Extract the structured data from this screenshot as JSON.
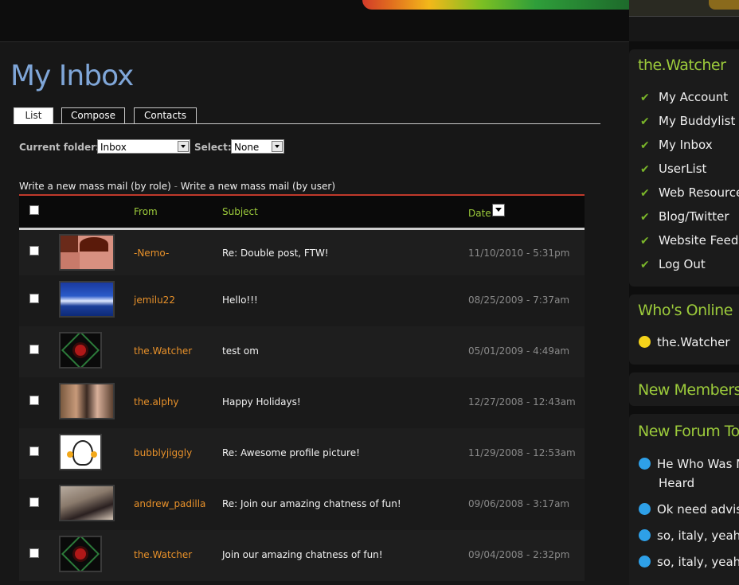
{
  "page": {
    "title": "My Inbox"
  },
  "tabs": [
    {
      "label": "List",
      "active": true
    },
    {
      "label": "Compose",
      "active": false
    },
    {
      "label": "Contacts",
      "active": false
    }
  ],
  "filters": {
    "folder_label": "Current folder:",
    "folder_value": "Inbox",
    "select_label": "Select:",
    "select_value": "None"
  },
  "massmail": {
    "by_role": "Write a new mass mail (by role)",
    "separator": "-",
    "by_user": "Write a new mass mail (by user)"
  },
  "table": {
    "headers": {
      "from": "From",
      "subject": "Subject",
      "date": "Date"
    },
    "rows": [
      {
        "from": "-Nemo-",
        "subject": "Re: Double post, FTW!",
        "date": "11/10/2010 - 5:31pm",
        "avatar": "nemo"
      },
      {
        "from": "jemilu22",
        "subject": "Hello!!!",
        "date": "08/25/2009 - 7:37am",
        "avatar": "wave"
      },
      {
        "from": "the.Watcher",
        "subject": "test om",
        "date": "05/01/2009 - 4:49am",
        "avatar": "symbol"
      },
      {
        "from": "the.alphy",
        "subject": "Happy Holidays!",
        "date": "12/27/2008 - 12:43am",
        "avatar": "couple"
      },
      {
        "from": "bubblyjiggly",
        "subject": "Re: Awesome profile picture!",
        "date": "11/29/2008 - 12:53am",
        "avatar": "ghost"
      },
      {
        "from": "andrew_padilla",
        "subject": "Re: Join our amazing chatness of fun!",
        "date": "09/06/2008 - 3:17am",
        "avatar": "man"
      },
      {
        "from": "the.Watcher",
        "subject": "Join our amazing chatness of fun!",
        "date": "09/04/2008 - 2:32pm",
        "avatar": "symbol"
      }
    ]
  },
  "sidebar": {
    "user_block": {
      "title": "the.Watcher",
      "items": [
        "My Account",
        "My Buddylist",
        "My Inbox",
        "UserList",
        "Web Resources",
        "Blog/Twitter",
        "Website Feeds",
        "Log Out"
      ]
    },
    "online": {
      "title": "Who's Online",
      "users": [
        "the.Watcher"
      ]
    },
    "members": {
      "title": "New Members"
    },
    "forum": {
      "title": "New Forum Topics",
      "topics": [
        {
          "line1": "He Who Was N",
          "line2": "Heard"
        },
        {
          "line1": "Ok need advis"
        },
        {
          "line1": "so, italy, yeah"
        },
        {
          "line1": "so, italy, yeah"
        }
      ]
    }
  },
  "colors": {
    "accent_green": "#9ccb3b",
    "from_orange": "#e8912a",
    "title_blue": "#7fa6d8",
    "header_rule": "#c0392b"
  }
}
